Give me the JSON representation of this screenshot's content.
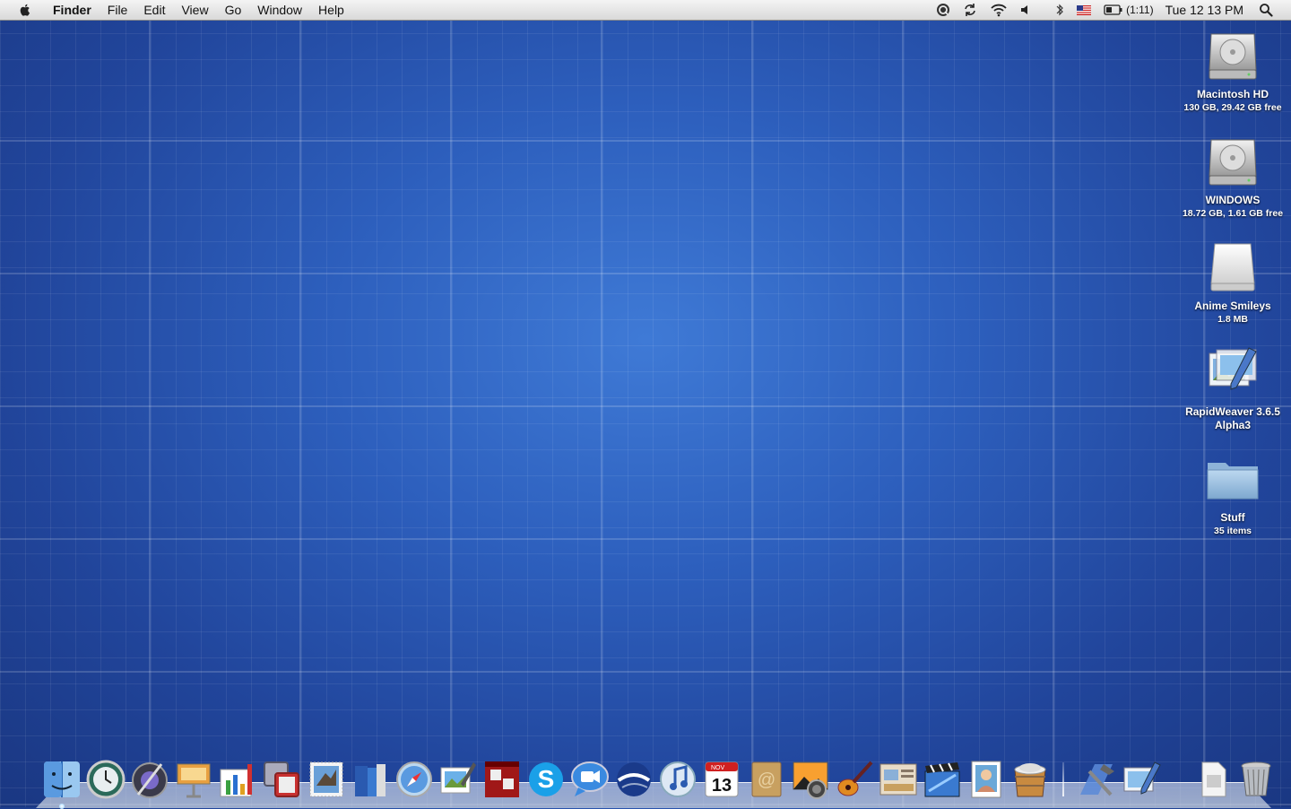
{
  "menubar": {
    "app_name": "Finder",
    "menus": [
      "File",
      "Edit",
      "View",
      "Go",
      "Window",
      "Help"
    ],
    "status_icons": [
      "quicksilver-icon",
      "sync-icon",
      "wifi-icon",
      "volume-icon",
      "bluetooth-icon",
      "us-flag-input-icon",
      "battery-icon"
    ],
    "battery_text": "(1:11)",
    "clock": "Tue 12 13 PM"
  },
  "desktop_icons": [
    {
      "name": "Macintosh HD",
      "info": "130 GB, 29.42 GB free",
      "icon": "hard-drive-icon"
    },
    {
      "name": "WINDOWS",
      "info": "18.72 GB, 1.61 GB free",
      "icon": "hard-drive-icon"
    },
    {
      "name": "Anime Smileys",
      "info": "1.8 MB",
      "icon": "disk-image-icon"
    },
    {
      "name": "RapidWeaver 3.6.5 Alpha3",
      "info": "",
      "icon": "rapidweaver-icon"
    },
    {
      "name": "Stuff",
      "info": "35 items",
      "icon": "folder-icon"
    }
  ],
  "dock": {
    "apps": [
      "finder",
      "time-machine",
      "aperture",
      "keynote",
      "numbers",
      "vmware",
      "mail-stamp",
      "books",
      "safari",
      "preview",
      "photo-booth",
      "skype",
      "ichat",
      "google-earth",
      "itunes",
      "ical",
      "address-book",
      "image-capture",
      "garageband",
      "iweb",
      "imovie",
      "photo-frame",
      "package",
      "xcode",
      "rapidweaver"
    ],
    "ical_day": "13",
    "ical_month": "NOV",
    "colors": {
      "accent": "#2d5fbd"
    }
  }
}
